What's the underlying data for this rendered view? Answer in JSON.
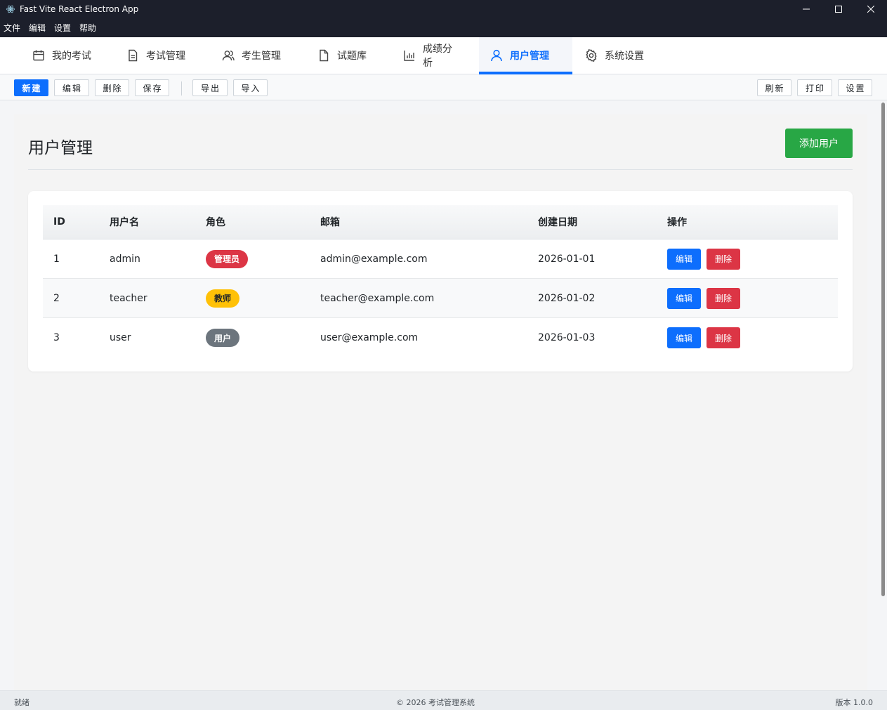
{
  "window": {
    "title": "Fast Vite React Electron App",
    "icon": "electron-icon"
  },
  "menubar": {
    "items": [
      "文件",
      "编辑",
      "设置",
      "帮助"
    ]
  },
  "tabs": [
    {
      "label": "我的考试",
      "icon": "calendar-icon"
    },
    {
      "label": "考试管理",
      "icon": "document-list-icon"
    },
    {
      "label": "考生管理",
      "icon": "users-icon"
    },
    {
      "label": "试题库",
      "icon": "file-icon"
    },
    {
      "label": "成绩分析",
      "icon": "bar-chart-icon"
    },
    {
      "label": "用户管理",
      "icon": "user-icon",
      "active": true
    },
    {
      "label": "系统设置",
      "icon": "gear-icon"
    }
  ],
  "toolbar": {
    "new": "新建",
    "edit": "编辑",
    "delete": "删除",
    "save": "保存",
    "export": "导出",
    "import": "导入",
    "refresh": "刷新",
    "print": "打印",
    "settings": "设置"
  },
  "page": {
    "title": "用户管理",
    "add_button": "添加用户"
  },
  "table": {
    "headers": [
      "ID",
      "用户名",
      "角色",
      "邮箱",
      "创建日期",
      "操作"
    ],
    "rows": [
      {
        "id": "1",
        "username": "admin",
        "role": "管理员",
        "role_type": "admin",
        "email": "admin@example.com",
        "created": "2026-01-01"
      },
      {
        "id": "2",
        "username": "teacher",
        "role": "教师",
        "role_type": "teacher",
        "email": "teacher@example.com",
        "created": "2026-01-02"
      },
      {
        "id": "3",
        "username": "user",
        "role": "用户",
        "role_type": "user",
        "email": "user@example.com",
        "created": "2026-01-03"
      }
    ],
    "edit_label": "编辑",
    "delete_label": "删除"
  },
  "colors": {
    "primary": "#0d6efd",
    "success": "#28a745",
    "danger": "#dc3545",
    "warning": "#ffc107",
    "secondary": "#6c757d"
  },
  "statusbar": {
    "left": "就绪",
    "center": "© 2026 考试管理系统",
    "right": "版本 1.0.0"
  }
}
